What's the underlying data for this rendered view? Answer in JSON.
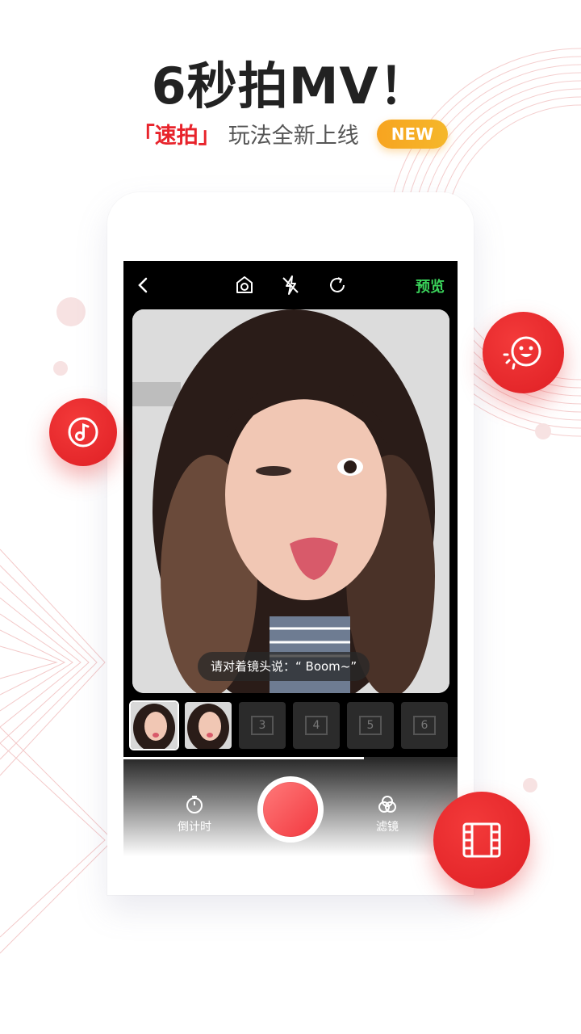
{
  "headline": "6秒拍MV！",
  "subline": {
    "accent": "「速拍」",
    "rest": "玩法全新上线",
    "badge": "NEW"
  },
  "camera": {
    "top_bar": {
      "back_icon": "chevron-left-icon",
      "icons": [
        "face-mask-icon",
        "flash-off-icon",
        "flip-camera-icon"
      ],
      "preview_label": "预览"
    },
    "prompt_text": "请对着镜头说：“ Boom~”",
    "clip_slots": [
      {
        "type": "photo"
      },
      {
        "type": "photo"
      },
      {
        "type": "empty",
        "number": "3"
      },
      {
        "type": "empty",
        "number": "4"
      },
      {
        "type": "empty",
        "number": "5"
      },
      {
        "type": "empty",
        "number": "6"
      }
    ],
    "progress": 0.72,
    "controls": {
      "countdown_label": "倒计时",
      "filter_label": "滤镜"
    }
  },
  "floating_buttons": [
    "music-note-icon",
    "smiley-face-icon",
    "film-strip-icon"
  ],
  "colors": {
    "accent": "#e8232b",
    "badge": "#f7a420",
    "preview_green": "#3ad25a"
  }
}
